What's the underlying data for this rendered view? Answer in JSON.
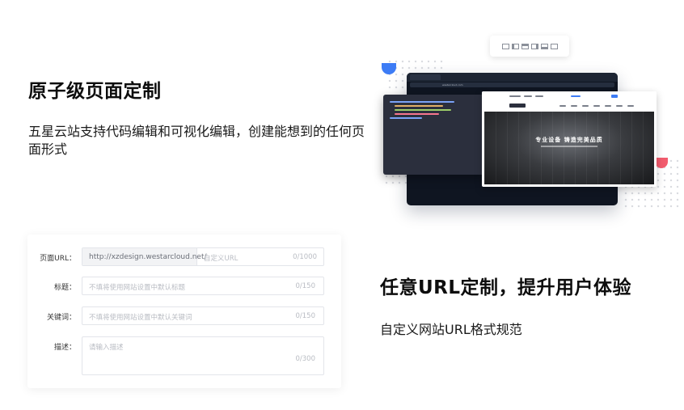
{
  "section1": {
    "title": "原子级页面定制",
    "desc": "五星云站支持代码编辑和可视化编辑，创建能想到的任何页面形式"
  },
  "section2": {
    "title": "任意URL定制，提升用户体验",
    "desc": "自定义网站URL格式规范"
  },
  "illustration": {
    "browser_url": "westarcloud.com",
    "hero_title": "专业设备  铸造完美品质",
    "toolbar_icons": [
      "layout-icon",
      "column-icon",
      "row-icon",
      "panel-icon",
      "grid-icon",
      "table-icon"
    ]
  },
  "form": {
    "url": {
      "label": "页面URL：",
      "prefix": "http://xzdesign.westarcloud.net/",
      "placeholder": "自定义URL",
      "count": "0/1000"
    },
    "title": {
      "label": "标题：",
      "placeholder": "不填将使用网站设置中默认标题",
      "count": "0/150"
    },
    "keywords": {
      "label": "关键词：",
      "placeholder": "不填将使用网站设置中默认关键词",
      "count": "0/150"
    },
    "desc": {
      "label": "描述：",
      "placeholder": "请输入描述",
      "count": "0/300"
    }
  },
  "colors": {
    "accent_blue": "#3d7cf5",
    "accent_red": "#f25c6e",
    "dark_panel": "#0f1521"
  }
}
